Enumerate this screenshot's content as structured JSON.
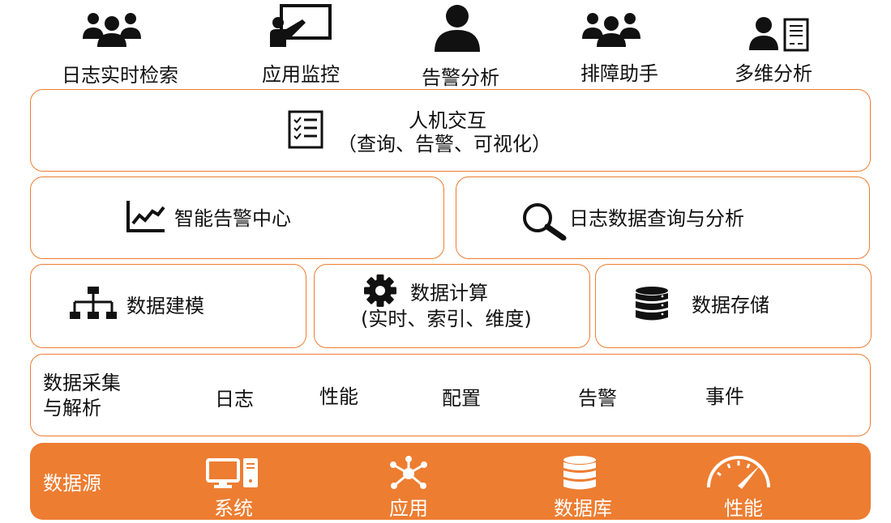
{
  "top_roles": [
    {
      "label": "日志实时检索",
      "icon": "users-group-icon"
    },
    {
      "label": "应用监控",
      "icon": "presenter-board-icon"
    },
    {
      "label": "告警分析",
      "icon": "user-icon"
    },
    {
      "label": "排障助手",
      "icon": "users-group-icon"
    },
    {
      "label": "多维分析",
      "icon": "user-document-icon"
    }
  ],
  "interaction": {
    "title": "人机交互",
    "subtitle": "（查询、告警、可视化）",
    "icon": "checklist-icon"
  },
  "alert_center": {
    "label": "智能告警中心",
    "icon": "line-chart-icon"
  },
  "log_search": {
    "label": "日志数据查询与分析",
    "icon": "search-icon"
  },
  "modeling": {
    "label": "数据建模",
    "icon": "hierarchy-icon"
  },
  "compute": {
    "title": "数据计算",
    "subtitle": "(实时、索引、维度)",
    "icon": "gear-icon"
  },
  "storage": {
    "label": "数据存储",
    "icon": "database-icon"
  },
  "collection": {
    "title_line1": "数据采集",
    "title_line2": "与解析",
    "items": [
      "日志",
      "性能",
      "配置",
      "告警",
      "事件"
    ]
  },
  "sources": {
    "title": "数据源",
    "items": [
      {
        "label": "系统",
        "icon": "computer-icon"
      },
      {
        "label": "应用",
        "icon": "network-hub-icon"
      },
      {
        "label": "数据库",
        "icon": "database-icon"
      },
      {
        "label": "性能",
        "icon": "speedometer-icon"
      }
    ]
  },
  "colors": {
    "accent": "#ed7d31",
    "border": "#ed7d31",
    "text": "#111111",
    "on_accent": "#ffffff"
  }
}
